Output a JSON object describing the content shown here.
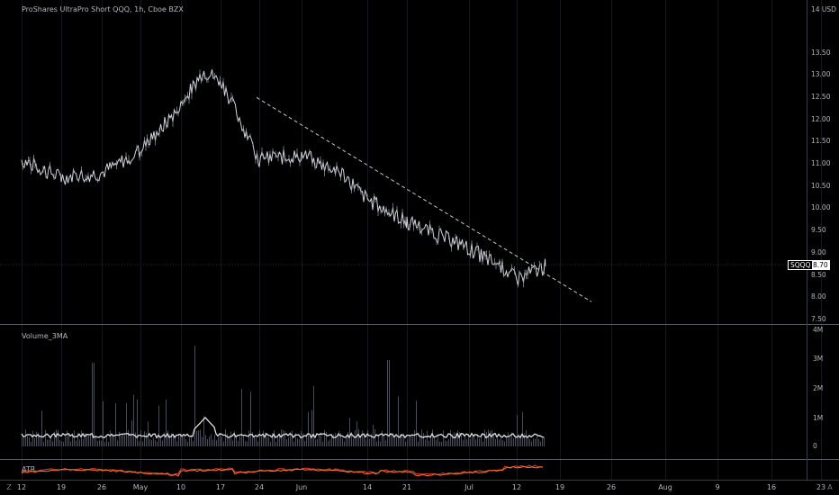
{
  "header": {
    "symbol_title": "ProShares UltraPro Short QQQ, 1h, Cboe BZX"
  },
  "price_scale": {
    "currency": "14 USD",
    "ticks": [
      "13.50",
      "13.00",
      "12.50",
      "12.00",
      "11.50",
      "11.00",
      "10.50",
      "10.00",
      "9.50",
      "9.00",
      "8.50",
      "8.00",
      "7.50"
    ],
    "last_price": "8.70",
    "symbol_badge": "SQQQ"
  },
  "volume_pane": {
    "title": "Volume_3MA",
    "ticks": [
      "4M",
      "3M",
      "2M",
      "1M",
      "0"
    ]
  },
  "atr_pane": {
    "title": "ATR"
  },
  "time_axis": {
    "ticks": [
      "12",
      "19",
      "26",
      "May",
      "10",
      "17",
      "24",
      "Jun",
      "14",
      "21",
      "Jul",
      "12",
      "19",
      "26",
      "Aug",
      "9",
      "16",
      "23"
    ]
  },
  "colors": {
    "background": "#000000",
    "price_line": "#d1d4dc",
    "trendline": "#c8c8c8",
    "atr_red": "#e53935",
    "atr_orange": "#ff7a1a"
  },
  "icons": {
    "goto_start": "z-icon",
    "settings": "gear-icon",
    "auto_scale": "a-icon"
  },
  "chart_data": [
    {
      "type": "line",
      "title": "ProShares UltraPro Short QQQ, 1h, Cboe BZX",
      "ylim": [
        7.5,
        14
      ],
      "x": [
        "Apr 12",
        "Apr 19",
        "Apr 26",
        "May 3",
        "May 10",
        "May 14",
        "May 17",
        "May 24",
        "Jun 1",
        "Jun 7",
        "Jun 14",
        "Jun 21",
        "Jul 1",
        "Jul 9",
        "Jul 12",
        "Jul 16"
      ],
      "series": [
        {
          "name": "SQQQ",
          "values": [
            11.1,
            10.7,
            10.8,
            11.3,
            12.3,
            13.1,
            12.9,
            11.1,
            11.2,
            10.8,
            10.2,
            9.7,
            9.1,
            8.7,
            8.4,
            8.7
          ]
        }
      ],
      "trendline": {
        "from": [
          "May 19",
          12.5
        ],
        "to": [
          "Jul 28",
          7.9
        ]
      }
    },
    {
      "type": "bar",
      "title": "Volume_3MA",
      "ylim": [
        0,
        4000000
      ],
      "peaks": [
        {
          "x": "Apr 26",
          "value": 2900000
        },
        {
          "x": "May 13",
          "value": 3500000
        },
        {
          "x": "Jun 21",
          "value": 3000000
        }
      ]
    }
  ]
}
